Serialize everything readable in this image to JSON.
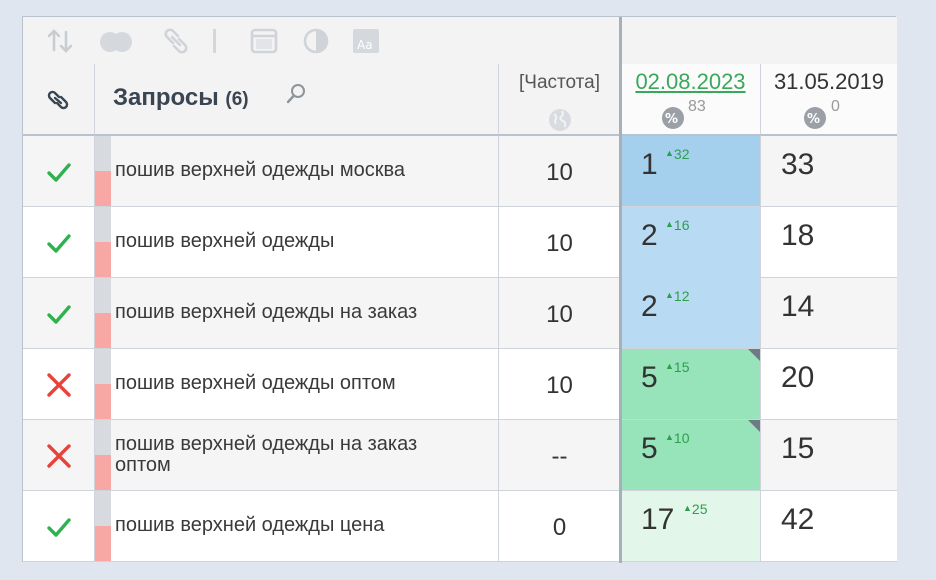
{
  "colors": {
    "check": "#2eb24f",
    "cross": "#e8433a",
    "pos_blue_dark": "#a4d0ee",
    "pos_blue_light": "#b8dbf3",
    "pos_green": "#97e3ba",
    "pos_green_light": "#e2f7ea",
    "date_link": "#3aa85b"
  },
  "toolbar": {
    "icons": [
      "sort-icon",
      "toggle-icon",
      "link-icon",
      "window-icon",
      "contrast-icon",
      "font-size-icon"
    ]
  },
  "header": {
    "query_title": "Запросы",
    "query_count": "(6)",
    "freq_label": "[Частота]",
    "date1": "02.08.2023",
    "date1_pct": "83",
    "date2": "31.05.2019",
    "date2_pct": "0"
  },
  "rows": [
    {
      "status": "check",
      "query": "пошив верхней одежды москва",
      "freq": "10",
      "pos": "1",
      "delta": "32",
      "pos_bg": "#a4d0ee",
      "corner": false,
      "pos2": "33"
    },
    {
      "status": "check",
      "query": "пошив верхней одежды",
      "freq": "10",
      "pos": "2",
      "delta": "16",
      "pos_bg": "#b8dbf3",
      "corner": false,
      "pos2": "18"
    },
    {
      "status": "check",
      "query": "пошив верхней одежды на заказ",
      "freq": "10",
      "pos": "2",
      "delta": "12",
      "pos_bg": "#b8dbf3",
      "corner": false,
      "pos2": "14"
    },
    {
      "status": "cross",
      "query": "пошив верхней одежды оптом",
      "freq": "10",
      "pos": "5",
      "delta": "15",
      "pos_bg": "#97e3ba",
      "corner": true,
      "pos2": "20"
    },
    {
      "status": "cross",
      "query": "пошив верхней одежды на заказ оптом",
      "freq": "--",
      "pos": "5",
      "delta": "10",
      "pos_bg": "#97e3ba",
      "corner": true,
      "pos2": "15"
    },
    {
      "status": "check",
      "query": "пошив верхней одежды цена",
      "freq": "0",
      "pos": "17",
      "delta": "25",
      "pos_bg": "#e2f7ea",
      "corner": false,
      "pos2": "42"
    }
  ]
}
